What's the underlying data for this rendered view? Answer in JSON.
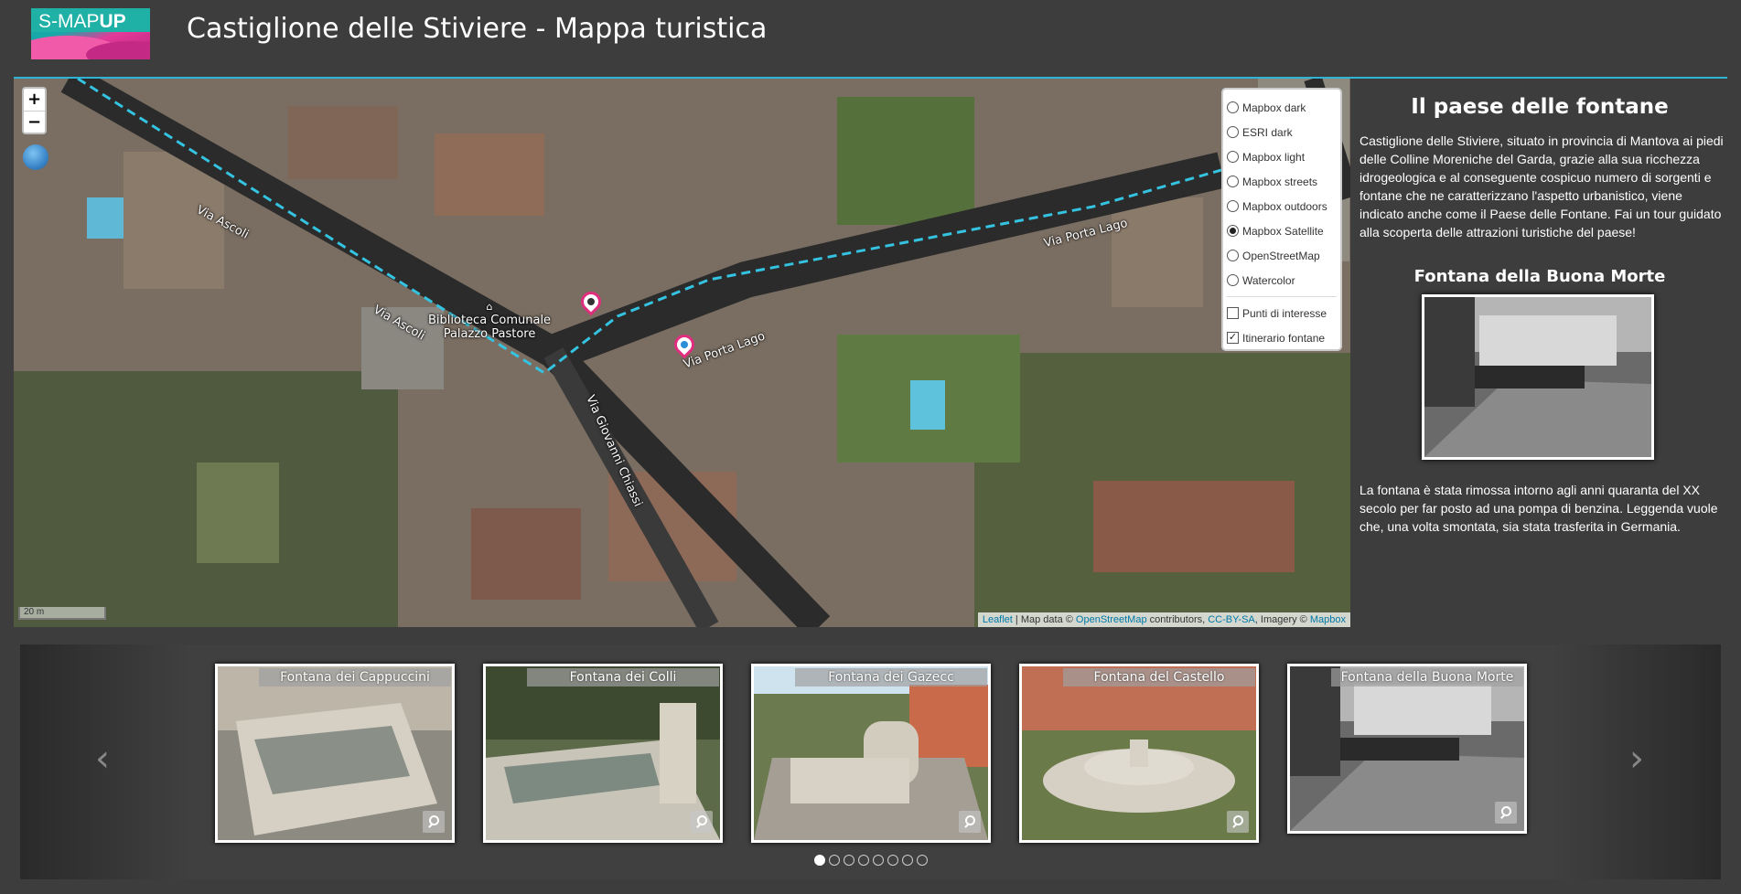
{
  "header": {
    "logo_text_light": "S-MAP",
    "logo_text_bold": "UP",
    "title": "Castiglione delle Stiviere - Mappa turistica"
  },
  "colors": {
    "background": "#3d3d3d",
    "accent_rule": "#2fb4d6",
    "route": "#34c3e0",
    "marker": "#e02e7e"
  },
  "map": {
    "zoom_in": "+",
    "zoom_out": "−",
    "scale": "20 m",
    "attribution": {
      "leaflet": "Leaflet",
      "text1": " | Map data © ",
      "osm": "OpenStreetMap",
      "text2": " contributors, ",
      "license": "CC-BY-SA",
      "text3": ", Imagery © ",
      "mapbox": "Mapbox"
    },
    "street_labels": [
      "Via Ascoli",
      "Via Ascoli",
      "Via Porta Lago",
      "Via Porta Lago",
      "Via Giovanni Chiassi"
    ],
    "poi_label_line1": "Biblioteca Comunale",
    "poi_label_line2": "Palazzo Pastore",
    "layers": {
      "base": [
        {
          "label": "Mapbox dark",
          "checked": false
        },
        {
          "label": "ESRI dark",
          "checked": false
        },
        {
          "label": "Mapbox light",
          "checked": false
        },
        {
          "label": "Mapbox streets",
          "checked": false
        },
        {
          "label": "Mapbox outdoors",
          "checked": false
        },
        {
          "label": "Mapbox Satellite",
          "checked": true
        },
        {
          "label": "OpenStreetMap",
          "checked": false
        },
        {
          "label": "Watercolor",
          "checked": false
        }
      ],
      "overlays": [
        {
          "label": "Punti di interesse",
          "checked": false
        },
        {
          "label": "Itinerario fontane",
          "checked": true
        }
      ]
    }
  },
  "side": {
    "title": "Il paese delle fontane",
    "intro": "Castiglione delle Stiviere, situato in provincia di Mantova ai piedi delle Colline Moreniche del Garda, grazie alla sua ricchezza idrogeologica e al conseguente cospicuo numero di sorgenti e fontane che ne caratterizzano l'aspetto urbanistico, viene indicato anche come il Paese delle Fontane. Fai un tour guidato alla scoperta delle attrazioni turistiche del paese!",
    "fountain_title": "Fontana della Buona Morte",
    "description": "La fontana è stata rimossa intorno agli anni quaranta del XX secolo per far posto ad una pompa di benzina. Leggenda vuole che, una volta smontata, sia stata trasferita in Germania."
  },
  "carousel": {
    "prev": "‹",
    "next": "›",
    "items": [
      {
        "title": "Fontana dei Cappuccini"
      },
      {
        "title": "Fontana dei Colli"
      },
      {
        "title": "Fontana dei Gazecc"
      },
      {
        "title": "Fontana del Castello"
      },
      {
        "title": "Fontana della Buona Morte"
      }
    ],
    "dot_count": 8,
    "active_dot": 0
  }
}
